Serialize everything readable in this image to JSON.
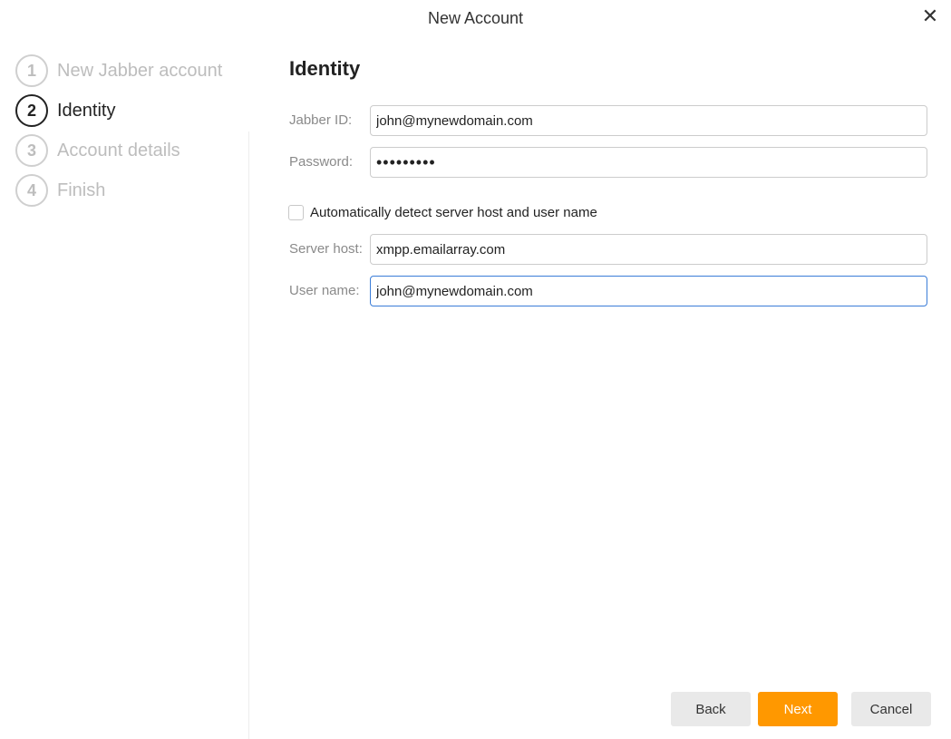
{
  "dialog": {
    "title": "New Account",
    "close_icon": "close-icon"
  },
  "steps": [
    {
      "number": "1",
      "label": "New Jabber account",
      "active": false
    },
    {
      "number": "2",
      "label": "Identity",
      "active": true
    },
    {
      "number": "3",
      "label": "Account details",
      "active": false
    },
    {
      "number": "4",
      "label": "Finish",
      "active": false
    }
  ],
  "form": {
    "title": "Identity",
    "jabber_id": {
      "label": "Jabber ID:",
      "value": "john@mynewdomain.com"
    },
    "password": {
      "label": "Password:",
      "value": "•••••••••"
    },
    "auto_detect": {
      "label": "Automatically detect server host and user name",
      "checked": false
    },
    "server_host": {
      "label": "Server host:",
      "value": "xmpp.emailarray.com"
    },
    "user_name": {
      "label": "User name:",
      "value": "john@mynewdomain.com"
    }
  },
  "buttons": {
    "back": "Back",
    "next": "Next",
    "cancel": "Cancel"
  },
  "colors": {
    "accent": "#ff9800",
    "focus": "#3b7dd8"
  }
}
